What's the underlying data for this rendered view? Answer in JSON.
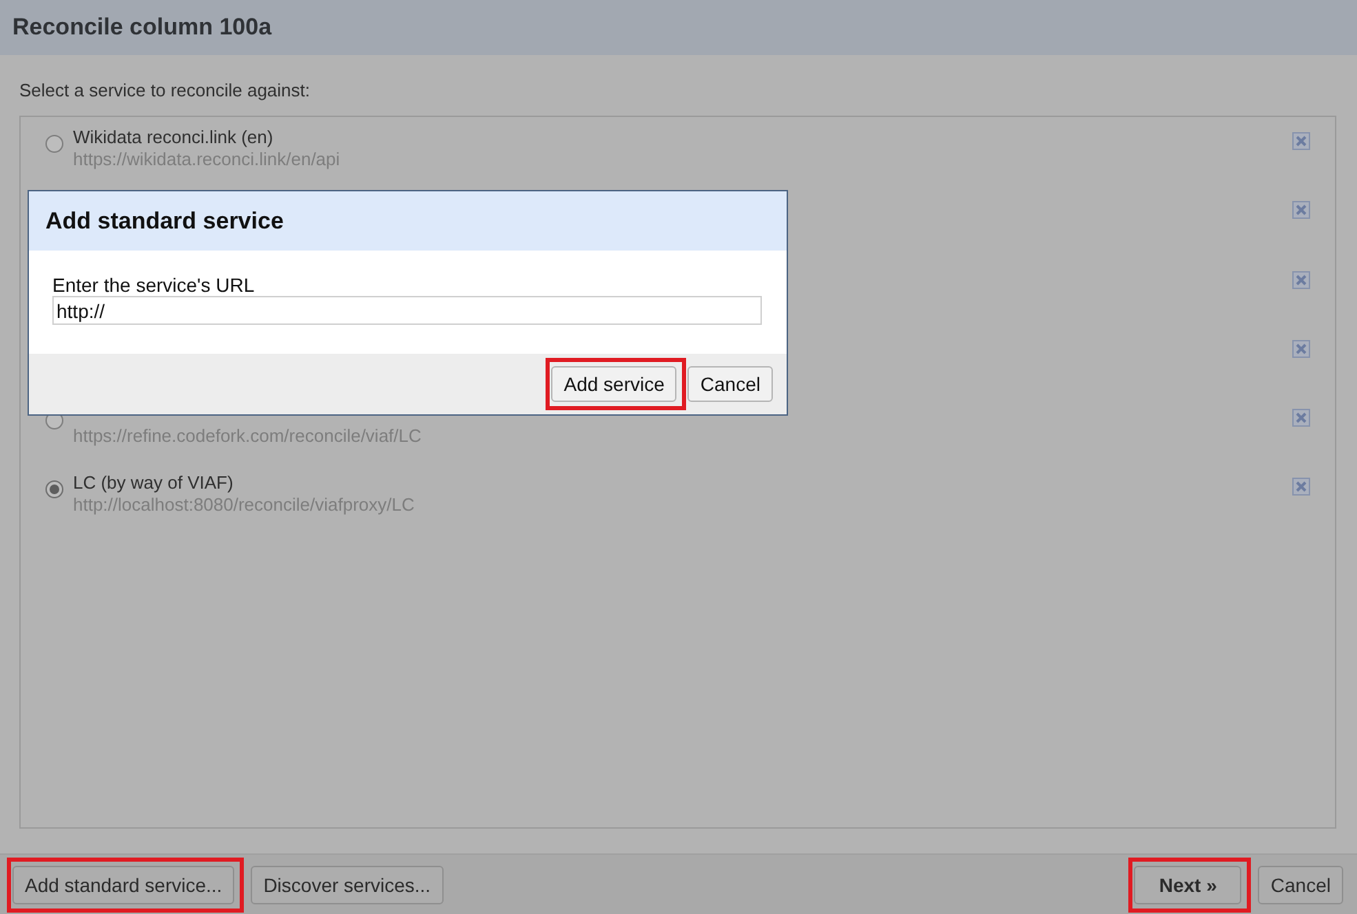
{
  "window": {
    "title": "Reconcile column 100a"
  },
  "prompt": "Select a service to reconcile against:",
  "services": [
    {
      "name": "Wikidata reconci.link (en)",
      "url": "https://wikidata.reconci.link/en/api",
      "selected": false,
      "removable": true
    },
    {
      "removable": true
    },
    {
      "removable": true
    },
    {
      "removable": true
    },
    {
      "url": "https://refine.codefork.com/reconcile/viaf/LC",
      "selected": false,
      "removable": true
    },
    {
      "name": "LC (by way of VIAF)",
      "url": "http://localhost:8080/reconcile/viafproxy/LC",
      "selected": true,
      "removable": true
    }
  ],
  "footer": {
    "left_buttons": [
      {
        "label": "Add standard service...",
        "kind": "plain",
        "highlighted": true
      },
      {
        "label": "Discover services...",
        "kind": "plain",
        "highlighted": false
      }
    ],
    "right_buttons": [
      {
        "label": "Next »",
        "kind": "primary",
        "highlighted": true
      },
      {
        "label": "Cancel",
        "kind": "plain",
        "highlighted": false
      }
    ]
  },
  "modal": {
    "title": "Add standard service",
    "field_label": "Enter the service's URL",
    "url_field": {
      "value": "http://"
    },
    "buttons": [
      {
        "label": "Add service",
        "kind": "plain",
        "highlighted": true
      },
      {
        "label": "Cancel",
        "kind": "plain",
        "highlighted": false
      }
    ]
  }
}
